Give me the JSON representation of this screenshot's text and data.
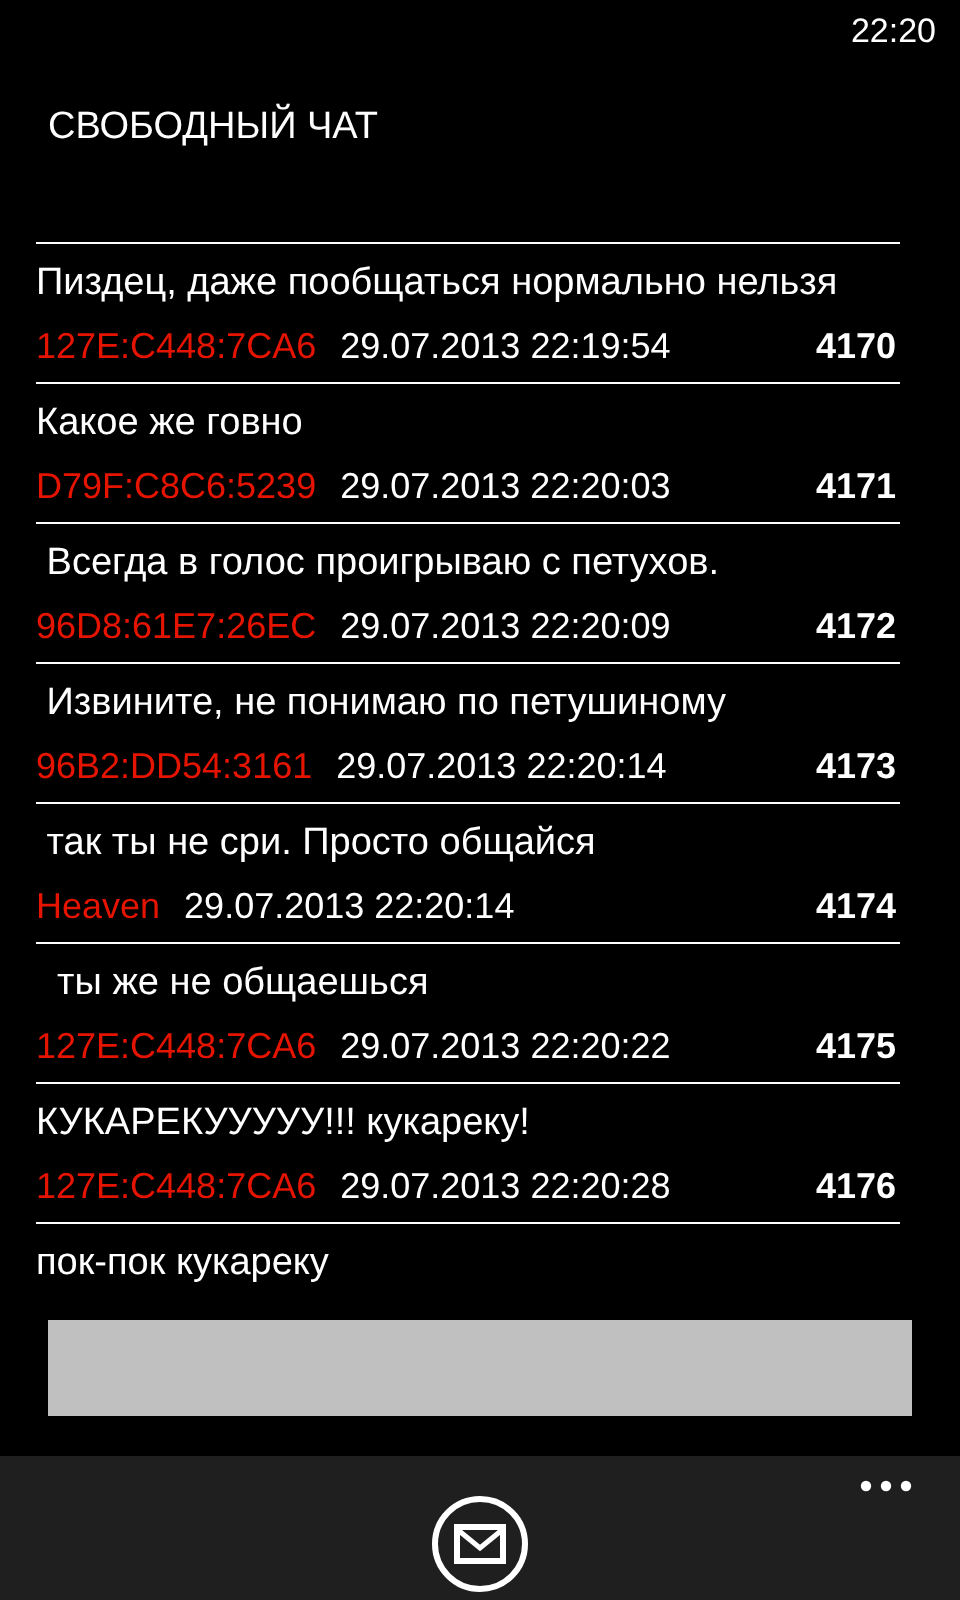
{
  "status_bar": {
    "time": "22:20"
  },
  "title": "СВОБОДНЫЙ ЧАТ",
  "messages": [
    {
      "text": "Пиздец, даже пообщаться нормально нельзя",
      "author": "127E:C448:7CA6",
      "datetime": "29.07.2013 22:19:54",
      "number": "4170"
    },
    {
      "text": "Какое же говно",
      "author": "D79F:C8C6:5239",
      "datetime": "29.07.2013 22:20:03",
      "number": "4171"
    },
    {
      "text": " Всегда в голос проигрываю с петухов.",
      "author": "96D8:61E7:26EC",
      "datetime": "29.07.2013 22:20:09",
      "number": "4172"
    },
    {
      "text": " Извините, не понимаю по петушиному",
      "author": "96B2:DD54:3161",
      "datetime": "29.07.2013 22:20:14",
      "number": "4173"
    },
    {
      "text": " так ты не сри. Просто общайся",
      "author": "Heaven",
      "datetime": "29.07.2013 22:20:14",
      "number": "4174"
    },
    {
      "text": "  ты же не общаешься",
      "author": "127E:C448:7CA6",
      "datetime": "29.07.2013 22:20:22",
      "number": "4175"
    },
    {
      "text": "КУКАРЕКУУУУУ!!! кукареку!",
      "author": "127E:C448:7CA6",
      "datetime": "29.07.2013 22:20:28",
      "number": "4176"
    },
    {
      "text": "пок-пок кукареку"
    }
  ]
}
